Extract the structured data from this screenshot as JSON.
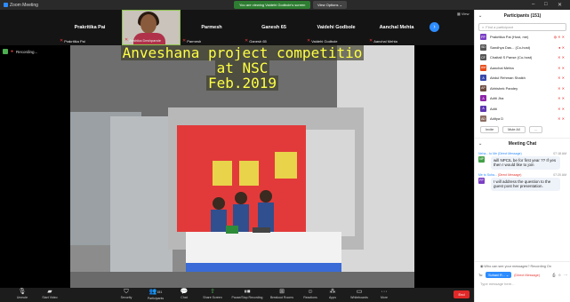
{
  "app": {
    "title": "Zoom Meeting"
  },
  "banner": {
    "text": "You are viewing Vaidehi Godbole's screen",
    "view_options": "View Options ⌄"
  },
  "strip": {
    "tiles": [
      {
        "title": "Prakritika Pai",
        "name": "Prakritika Pai"
      },
      {
        "title": "",
        "name": "Anshika Deshpande"
      },
      {
        "title": "Parmesh",
        "name": "Parmesh"
      },
      {
        "title": "Ganesh 65",
        "name": "Ganesh 65"
      },
      {
        "title": "Vaidehi Godbole",
        "name": "Vaidehi Godbole"
      },
      {
        "title": "Aanchal Mehta",
        "name": "Aanchal Mehta"
      }
    ],
    "view_label": "View"
  },
  "recording": {
    "label": "Recording..."
  },
  "slide": {
    "line1": "Anveshana project competitio",
    "line2": "at NSC",
    "line3": "Feb.2019"
  },
  "toolbar": {
    "items": [
      {
        "label": "Unmute",
        "icon": "microphone-icon"
      },
      {
        "label": "Start Video",
        "icon": "video-icon"
      },
      {
        "label": "Security",
        "icon": "shield-icon"
      },
      {
        "label": "Participants",
        "icon": "participants-icon",
        "count": "151"
      },
      {
        "label": "Chat",
        "icon": "chat-icon"
      },
      {
        "label": "Share Screen",
        "icon": "share-icon"
      },
      {
        "label": "Pause/Stop Recording",
        "icon": "record-icon"
      },
      {
        "label": "Breakout Rooms",
        "icon": "breakout-icon"
      },
      {
        "label": "Reactions",
        "icon": "reactions-icon"
      },
      {
        "label": "Apps",
        "icon": "apps-icon"
      },
      {
        "label": "Whiteboards",
        "icon": "whiteboard-icon"
      },
      {
        "label": "More",
        "icon": "more-icon"
      }
    ],
    "end": "End"
  },
  "participants": {
    "title": "Participants (151)",
    "search_placeholder": "Find a participant",
    "list": [
      {
        "initials": "PP",
        "name": "Prakritika Pai (Host, me)",
        "color": "#7b3fc4"
      },
      {
        "initials": "SD",
        "name": "Sandhya Das... (Co-host)",
        "color": "#555555"
      },
      {
        "initials": "CF",
        "name": "Chaitali S Panse (Co-host)",
        "color": "#555555"
      },
      {
        "initials": "AM",
        "name": "Aanchal Mehta",
        "color": "#e64a19"
      },
      {
        "initials": "A",
        "name": "Abdul Rehman Shaikh",
        "color": "#3949ab"
      },
      {
        "initials": "AP",
        "name": "Abhishek Pandey",
        "color": "#6d4c41"
      },
      {
        "initials": "A",
        "name": "Aditi Jha",
        "color": "#8e24aa"
      },
      {
        "initials": "A",
        "name": "Aditi",
        "color": "#5e35b1"
      },
      {
        "initials": "AD",
        "name": "Aditya D",
        "color": "#8d6e63"
      }
    ],
    "invite": "Invite",
    "mute_all": "Mute All",
    "more": "..."
  },
  "chat": {
    "title": "Meeting Chat",
    "messages": [
      {
        "from": "Neha... to Me (Direct Message)",
        "time": "07:18 AM",
        "initials": "NP",
        "color": "#43a047",
        "text": "will NPCIL be for first year ?? If yes then I would like to join"
      },
      {
        "from": "Me to Suha...",
        "dm": "(Direct Message)",
        "time": "07:20 AM",
        "initials": "PP",
        "color": "#7b3fc4",
        "text": "I will address the question to the guest post her presentation."
      }
    ],
    "who_can_see": "Who can see your messages? Recording On",
    "to_label": "To:",
    "to_value": "Suhani R... ⌄",
    "dm_label": "(Direct Message)",
    "placeholder": "Type message here..."
  }
}
